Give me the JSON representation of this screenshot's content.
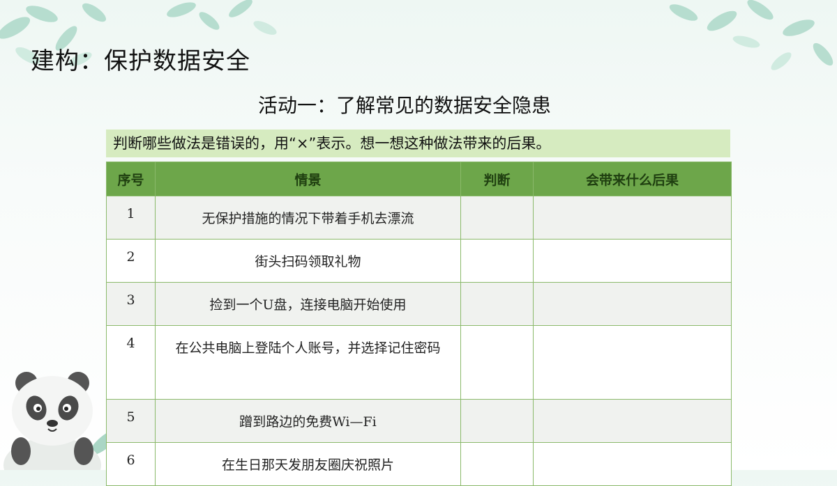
{
  "slide": {
    "title": "建构：保护数据安全",
    "activity_title": "活动一：了解常见的数据安全隐患",
    "instruction": "判断哪些做法是错误的，用“×”表示。想一想这种做法带来的后果。"
  },
  "table": {
    "headers": [
      "序号",
      "情景",
      "判断",
      "会带来什么后果"
    ],
    "rows": [
      {
        "num": "1",
        "scene": "无保护措施的情况下带着手机去漂流",
        "judge": "",
        "consequence": ""
      },
      {
        "num": "2",
        "scene": "街头扫码领取礼物",
        "judge": "",
        "consequence": ""
      },
      {
        "num": "3",
        "scene": "捡到一个U盘，连接电脑开始使用",
        "judge": "",
        "consequence": ""
      },
      {
        "num": "4",
        "scene": "在公共电脑上登陆个人账号，并选择记住密码",
        "judge": "",
        "consequence": ""
      },
      {
        "num": "5",
        "scene": "蹭到路边的免费Wi—Fi",
        "judge": "",
        "consequence": ""
      },
      {
        "num": "6",
        "scene": "在生日那天发朋友圈庆祝照片",
        "judge": "",
        "consequence": ""
      }
    ]
  },
  "colors": {
    "header_bg": "#6da64a",
    "instruction_bg": "#d6ebc0",
    "row_alt_bg": "#f0f2ef",
    "border": "#8ab96a"
  }
}
